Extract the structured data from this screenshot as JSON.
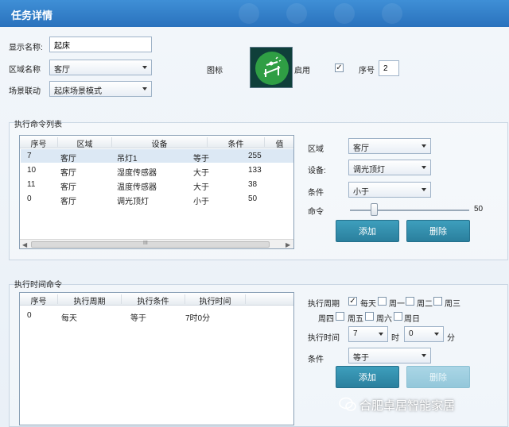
{
  "window": {
    "title": "任务详情"
  },
  "form": {
    "display_name_label": "显示名称:",
    "display_name_value": "起床",
    "area_label": "区域名称",
    "area_value": "客厅",
    "scene_label": "场景联动",
    "scene_value": "起床场景模式",
    "icon_label": "图标",
    "enable_label": "启用",
    "enable_checked": true,
    "seq_label": "序号",
    "seq_value": "2"
  },
  "command_list": {
    "title": "执行命令列表",
    "columns": [
      "序号",
      "区域",
      "设备",
      "条件",
      "值"
    ],
    "rows": [
      [
        "7",
        "客厅",
        "吊灯1",
        "等于",
        "255"
      ],
      [
        "10",
        "客厅",
        "湿度传感器",
        "大于",
        "133"
      ],
      [
        "11",
        "客厅",
        "温度传感器",
        "大于",
        "38"
      ],
      [
        "0",
        "客厅",
        "调光顶灯",
        "小于",
        "50"
      ]
    ],
    "selected_row": 0,
    "scroll_thumb_label": "III",
    "area_label": "区域",
    "area_value": "客厅",
    "device_label": "设备:",
    "device_value": "调光顶灯",
    "condition_label": "条件",
    "condition_value": "小于",
    "command_label": "命令",
    "command_value": "50",
    "command_level_fraction": 0.2,
    "add_button": "添加",
    "delete_button": "删除"
  },
  "time_command": {
    "title": "执行时间命令",
    "columns": [
      "序号",
      "执行周期",
      "执行条件",
      "执行时间"
    ],
    "rows": [
      [
        "0",
        "每天",
        "等于",
        "7时0分"
      ]
    ],
    "period_label": "执行周期",
    "days": [
      {
        "label": "每天",
        "checked": true
      },
      {
        "label": "周一",
        "checked": false
      },
      {
        "label": "周二",
        "checked": false
      },
      {
        "label": "周三",
        "checked": false
      },
      {
        "label": "周四",
        "checked": false
      },
      {
        "label": "周五",
        "checked": false
      },
      {
        "label": "周六",
        "checked": false
      },
      {
        "label": "周日",
        "checked": false
      }
    ],
    "time_label": "执行时间",
    "hour_value": "7",
    "hour_unit": "时",
    "minute_value": "0",
    "minute_unit": "分",
    "condition_label": "条件",
    "condition_value": "等于",
    "add_button": "添加",
    "delete_button": "删除"
  },
  "watermark": {
    "text": "合肥卓居智能家居"
  },
  "colors": {
    "titlebar": "#2f7cc7",
    "primary_button": "#318ead",
    "icon_green": "#2f9e44"
  }
}
